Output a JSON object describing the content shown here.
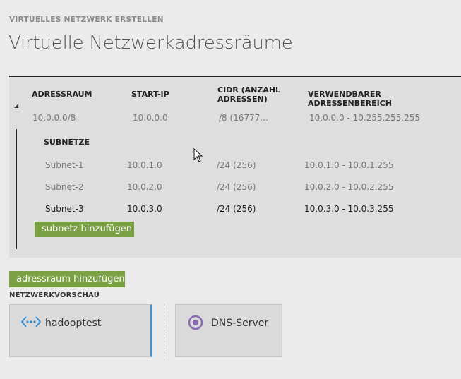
{
  "header": {
    "wizard_step": "VIRTUELLES NETZWERK ERSTELLEN",
    "title": "Virtuelle Netzwerkadressräume"
  },
  "table": {
    "columns": {
      "address_space": "ADRESSRAUM",
      "start_ip": "START-IP",
      "cidr_line1": "CIDR (ANZAHL",
      "cidr_line2": "ADRESSEN)",
      "usable_range": "VERWENDBARER ADRESSENBEREICH"
    },
    "address_space": {
      "address": "10.0.0.0/8",
      "start_ip": "10.0.0.0",
      "cidr": "/8 (16777...",
      "range": "10.0.0.0 - 10.255.255.255"
    },
    "subnets_title": "SUBNETZE",
    "subnets": [
      {
        "name": "Subnet-1",
        "start_ip": "10.0.1.0",
        "cidr": "/24 (256)",
        "range": "10.0.1.0 - 10.0.1.255"
      },
      {
        "name": "Subnet-2",
        "start_ip": "10.0.2.0",
        "cidr": "/24 (256)",
        "range": "10.0.2.0 - 10.0.2.255"
      },
      {
        "name": "Subnet-3",
        "start_ip": "10.0.3.0",
        "cidr": "/24 (256)",
        "range": "10.0.3.0 - 10.0.3.255"
      }
    ],
    "add_subnet_label": "subnetz hinzufügen"
  },
  "add_address_space_label": "adressraum hinzufügen",
  "preview": {
    "title": "NETZWERKVORSCHAU",
    "network_name": "hadooptest",
    "dns_label": "DNS-Server"
  },
  "colors": {
    "accent_green": "#7aa144",
    "network_icon": "#3b8fd0",
    "dns_icon": "#8a6bb3"
  }
}
